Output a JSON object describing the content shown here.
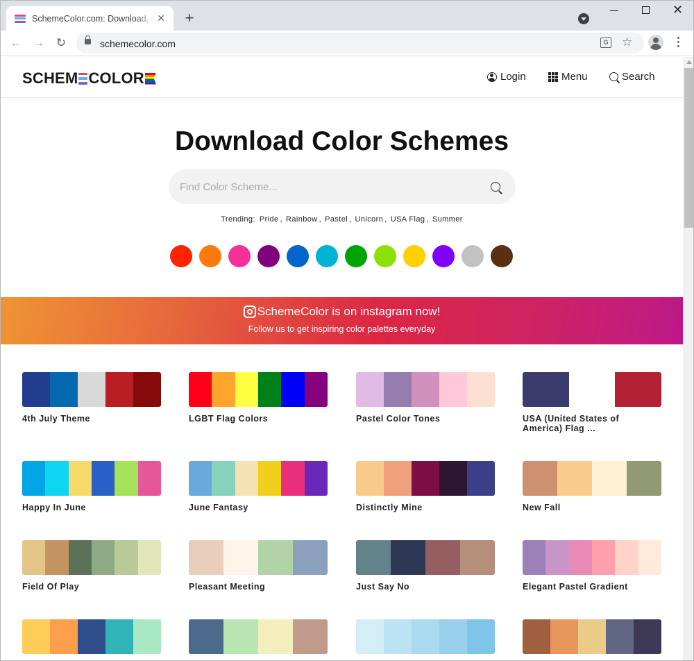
{
  "browser": {
    "tab_title": "SchemeColor.com: Download, create, edit color schemes",
    "tab_close": "✕",
    "new_tab": "+",
    "url": "schemecolor.com",
    "window_close": "✕"
  },
  "header": {
    "logo_left": "SCHEM",
    "logo_right": "COLOR",
    "logo_e_colors": [
      "#e2467f",
      "#62b4e8",
      "#8b5dcb"
    ],
    "nav": {
      "login": "Login",
      "menu": "Menu",
      "search": "Search"
    }
  },
  "hero": {
    "title": "Download Color Schemes",
    "search_placeholder": "Find Color Scheme...",
    "trending_label": "Trending:",
    "trending": [
      "Pride",
      "Rainbow",
      "Pastel",
      "Unicorn",
      "USA Flag",
      "Summer"
    ],
    "color_dots": [
      "#ff2400",
      "#ff7a0a",
      "#f72f9b",
      "#800080",
      "#0066cc",
      "#00b3d6",
      "#00a400",
      "#8ee000",
      "#ffd000",
      "#8000ff",
      "#c2c2c2",
      "#5a2f12"
    ]
  },
  "banner": {
    "title": "SchemeColor is on instagram now!",
    "subtitle": "Follow us to get inspiring color palettes everyday"
  },
  "palettes": [
    {
      "name": "4th July Theme",
      "colors": [
        "#233d8e",
        "#0668ae",
        "#d9d9d9",
        "#b71f25",
        "#850b0b"
      ]
    },
    {
      "name": "LGBT Flag Colors",
      "colors": [
        "#ff0018",
        "#ffa52c",
        "#ffff41",
        "#008018",
        "#0000f9",
        "#86007d"
      ]
    },
    {
      "name": "Pastel Color Tones",
      "colors": [
        "#e0bbe4",
        "#957dad",
        "#d291bc",
        "#fec8d8",
        "#ffdfd3"
      ]
    },
    {
      "name": "USA (United States of America) Flag ...",
      "colors": [
        "#3c3b6e",
        "#ffffff",
        "#b22234"
      ]
    },
    {
      "name": "Happy In June",
      "colors": [
        "#00a6e3",
        "#0ed5f0",
        "#f5da6a",
        "#2b5fc8",
        "#a4e25a",
        "#e5569b"
      ]
    },
    {
      "name": "June Fantasy",
      "colors": [
        "#6aa9dc",
        "#88d1bd",
        "#f4e1b4",
        "#f1cf1c",
        "#e72f7c",
        "#6b27b8"
      ]
    },
    {
      "name": "Distinctly Mine",
      "colors": [
        "#f8cb8d",
        "#f0a07c",
        "#7b0e47",
        "#2d1634",
        "#3c4089"
      ]
    },
    {
      "name": "New Fall",
      "colors": [
        "#cc9270",
        "#f9cb8c",
        "#fef0d4",
        "#929a73"
      ]
    },
    {
      "name": "Field Of Play",
      "colors": [
        "#e2c587",
        "#c39461",
        "#5b7158",
        "#8eaa84",
        "#b8ca97",
        "#e1e6bb"
      ]
    },
    {
      "name": "Pleasant Meeting",
      "colors": [
        "#e8cebb",
        "#fdf5e9",
        "#b2d3a8",
        "#8aa0bd"
      ]
    },
    {
      "name": "Just Say No",
      "colors": [
        "#648289",
        "#2d3855",
        "#955f62",
        "#b58f7b"
      ]
    },
    {
      "name": "Elegant Pastel Gradient",
      "colors": [
        "#9b81b8",
        "#c994c7",
        "#e78ab8",
        "#fda0ab",
        "#fed3ca",
        "#ffebdc"
      ]
    },
    {
      "name": "",
      "colors": [
        "#fecd57",
        "#fd9f4a",
        "#304e8c",
        "#31b4b8",
        "#a8e8c2"
      ]
    },
    {
      "name": "",
      "colors": [
        "#4b6a8c",
        "#bae6b4",
        "#f4eebd",
        "#c09b8b"
      ]
    },
    {
      "name": "",
      "colors": [
        "#d3eef6",
        "#bbe3f3",
        "#a9daf0",
        "#97cfed",
        "#7fc5ea"
      ]
    },
    {
      "name": "",
      "colors": [
        "#a05f3d",
        "#e8975c",
        "#ebcb8a",
        "#626685",
        "#3c3855"
      ]
    }
  ]
}
